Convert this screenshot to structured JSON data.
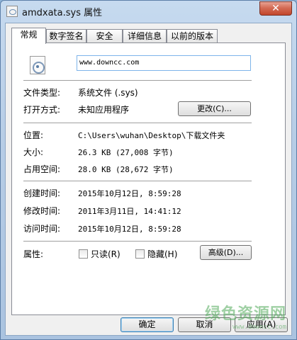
{
  "window": {
    "title": "amdxata.sys 属性",
    "close_label": "✕"
  },
  "tabs": [
    {
      "label": "常规",
      "active": true
    },
    {
      "label": "数字签名"
    },
    {
      "label": "安全"
    },
    {
      "label": "详细信息"
    },
    {
      "label": "以前的版本"
    }
  ],
  "general": {
    "file_name": "www.downcc.com",
    "file_type_label": "文件类型:",
    "file_type_value": "系统文件 (.sys)",
    "opens_with_label": "打开方式:",
    "opens_with_value": "未知应用程序",
    "change_button": "更改(C)...",
    "location_label": "位置:",
    "location_value": "C:\\Users\\wuhan\\Desktop\\下载文件夹",
    "size_label": "大小:",
    "size_value": "26.3 KB (27,008 字节)",
    "size_on_disk_label": "占用空间:",
    "size_on_disk_value": "28.0 KB (28,672 字节)",
    "created_label": "创建时间:",
    "created_value": "2015年10月12日, 8:59:28",
    "modified_label": "修改时间:",
    "modified_value": "2011年3月11日, 14:41:12",
    "accessed_label": "访问时间:",
    "accessed_value": "2015年10月12日, 8:59:28",
    "attributes_label": "属性:",
    "readonly_label": "只读(R)",
    "hidden_label": "隐藏(H)",
    "advanced_button": "高级(D)..."
  },
  "footer": {
    "ok": "确定",
    "cancel": "取消",
    "apply": "应用(A)"
  },
  "watermark": {
    "main": "绿色资源网",
    "sub": "www.downcc.com"
  }
}
